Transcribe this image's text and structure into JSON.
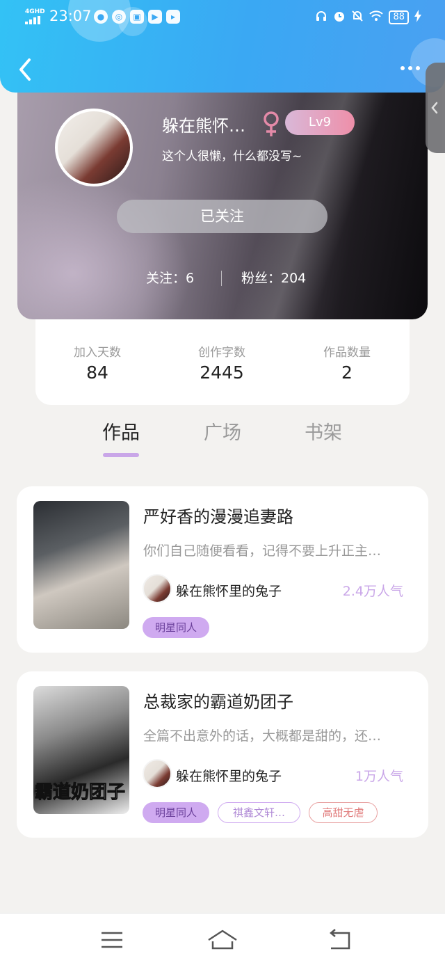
{
  "status_bar": {
    "network": "4GHD",
    "time": "23:07",
    "battery": "88"
  },
  "profile": {
    "username": "躲在熊怀…",
    "level": "Lv9",
    "bio": "这个人很懒，什么都没写~",
    "follow_button": "已关注",
    "following": "关注：6",
    "fans": "粉丝：204",
    "gender": "female"
  },
  "stats": [
    {
      "label": "加入天数",
      "value": "84"
    },
    {
      "label": "创作字数",
      "value": "2445"
    },
    {
      "label": "作品数量",
      "value": "2"
    }
  ],
  "tabs": [
    {
      "label": "作品",
      "active": true
    },
    {
      "label": "广场",
      "active": false
    },
    {
      "label": "书架",
      "active": false
    }
  ],
  "works": [
    {
      "title": "严好香的漫漫追妻路",
      "description": "你们自己随便看看，记得不要上升正主…",
      "author": "躲在熊怀里的兔子",
      "popularity": "2.4万人气",
      "tags": [
        "明星同人"
      ]
    },
    {
      "title": "总裁家的霸道奶团子",
      "description": "全篇不出意外的话，大概都是甜的，还…",
      "author": "躲在熊怀里的兔子",
      "popularity": "1万人气",
      "cover_text": "霸道奶团子",
      "tags": [
        "明星同人",
        "祺鑫文轩…",
        "高甜无虐"
      ]
    }
  ],
  "colors": {
    "header": "#3aa8f3",
    "accent_purple": "#c9a6e8",
    "tag_red": "#e07a7a"
  }
}
